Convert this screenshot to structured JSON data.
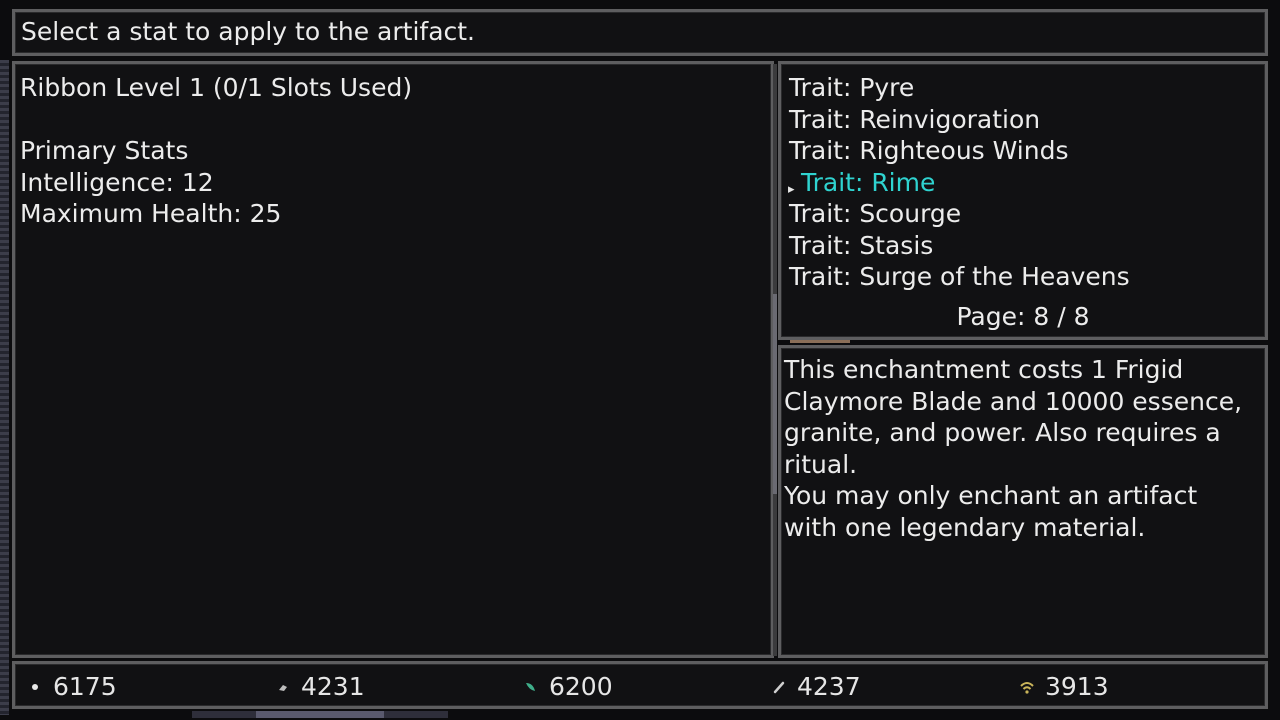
{
  "prompt": {
    "text": "Select a stat to apply to the artifact."
  },
  "artifact": {
    "header": "Ribbon Level 1 (0/1 Slots Used)",
    "primary_stats_label": "Primary Stats",
    "stats": [
      "Intelligence: 12",
      "Maximum Health: 25"
    ]
  },
  "trait_list": {
    "items": [
      "Trait: Pyre",
      "Trait: Reinvigoration",
      "Trait: Righteous Winds",
      "Trait: Rime",
      "Trait: Scourge",
      "Trait: Stasis",
      "Trait: Surge of the Heavens"
    ],
    "selected_index": 3,
    "selected_color": "#2fd3d0",
    "page": "Page: 8 / 8"
  },
  "description": {
    "text": "This enchantment costs 1 Frigid\nClaymore Blade and 10000 essence,\ngranite, and power. Also requires a\nritual.\nYou may only enchant an artifact\nwith one legendary material."
  },
  "resources": [
    {
      "icon": "essence-orb-icon",
      "value": "6175"
    },
    {
      "icon": "granite-shard-icon",
      "value": "4231"
    },
    {
      "icon": "leaf-icon",
      "value": "6200"
    },
    {
      "icon": "feather-icon",
      "value": "4237"
    },
    {
      "icon": "wifi-arc-icon",
      "value": "3913"
    }
  ],
  "colors": {
    "panel_border": "#5e5e60",
    "panel_background": "#111113",
    "text": "#ececec",
    "highlight": "#2fd3d0"
  }
}
